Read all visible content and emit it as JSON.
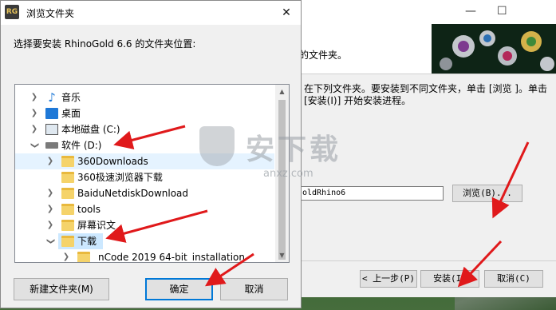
{
  "dialog": {
    "app_icon_text": "RG",
    "title": "浏览文件夹",
    "close_glyph": "✕",
    "prompt": "选择要安装 RhinoGold 6.6 的文件夹位置:",
    "tree": [
      {
        "label": "音乐",
        "icon": "music-icon",
        "expanded": false
      },
      {
        "label": "桌面",
        "icon": "desktop-icon",
        "expanded": false
      },
      {
        "label": "本地磁盘 (C:)",
        "icon": "pc-drive-icon",
        "expanded": false
      },
      {
        "label": "软件 (D:)",
        "icon": "drive-icon",
        "expanded": true
      },
      {
        "label": "360Downloads",
        "icon": "folder-icon"
      },
      {
        "label": "360极速浏览器下载",
        "icon": "folder-icon"
      },
      {
        "label": "BaiduNetdiskDownload",
        "icon": "folder-icon"
      },
      {
        "label": "tools",
        "icon": "folder-icon"
      },
      {
        "label": "屏幕识文",
        "icon": "folder-icon"
      },
      {
        "label": "下载",
        "icon": "folder-icon",
        "selected": true
      },
      {
        "label": "_nCode 2019 64-bit_installation",
        "icon": "folder-icon"
      }
    ],
    "buttons": {
      "new_folder": "新建文件夹(M)",
      "ok": "确定",
      "cancel": "取消"
    }
  },
  "installer": {
    "header_text": "的文件夹。",
    "description": "在下列文件夹。要安装到不同文件夹，单击 [浏览 ]。单击 [安装(I)] 开始安装进程。",
    "path_value": "oldRhino6",
    "browse_button": "浏览(B)...",
    "back_button": "< 上一步(P)",
    "install_button": "安装(I)",
    "cancel_button": "取消(C)",
    "minimize_glyph": "—",
    "maximize_glyph": "☐"
  },
  "watermark": {
    "cn": "安下载",
    "en": "anxz.com"
  },
  "colors": {
    "selection": "#cce8ff",
    "default_button_border": "#0078d7",
    "arrow": "#e0191b"
  }
}
